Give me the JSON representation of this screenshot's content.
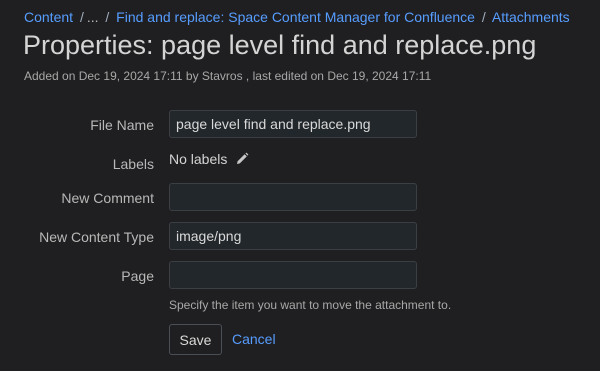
{
  "breadcrumb": {
    "items": [
      "Content",
      "...",
      "Find and replace: Space Content Manager for Confluence",
      "Attachments"
    ],
    "separator": "/"
  },
  "page": {
    "title": "Properties: page level find and replace.png",
    "meta": "Added on Dec 19, 2024 17:11 by Stavros , last edited on Dec 19, 2024 17:11"
  },
  "form": {
    "file_name": {
      "label": "File Name",
      "value": "page level find and replace.png"
    },
    "labels": {
      "label": "Labels",
      "value": "No labels"
    },
    "new_comment": {
      "label": "New Comment",
      "value": ""
    },
    "new_content_type": {
      "label": "New Content Type",
      "value": "image/png"
    },
    "page": {
      "label": "Page",
      "value": "",
      "hint": "Specify the item you want to move the attachment to."
    },
    "save_label": "Save",
    "cancel_label": "Cancel"
  },
  "icons": {
    "edit_labels": "pencil-icon"
  },
  "colors": {
    "background": "#1f1f21",
    "link": "#579dff",
    "field_background": "#22272b"
  }
}
